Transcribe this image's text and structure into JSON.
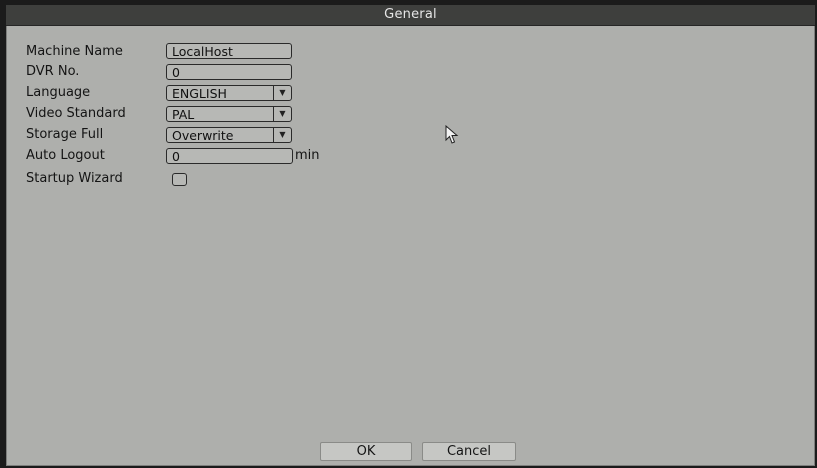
{
  "window": {
    "title": "General"
  },
  "form": {
    "machine_name": {
      "label": "Machine Name",
      "value": "LocalHost"
    },
    "dvr_no": {
      "label": "DVR No.",
      "value": "0"
    },
    "language": {
      "label": "Language",
      "value": "ENGLISH"
    },
    "video_standard": {
      "label": "Video Standard",
      "value": "PAL"
    },
    "storage_full": {
      "label": "Storage Full",
      "value": "Overwrite"
    },
    "auto_logout": {
      "label": "Auto Logout",
      "value": "0",
      "unit": "min"
    },
    "startup_wizard": {
      "label": "Startup Wizard",
      "checked": false
    }
  },
  "buttons": {
    "ok": "OK",
    "cancel": "Cancel"
  },
  "icons": {
    "dropdown": "chevron-down-icon",
    "pointer": "mouse-pointer-icon"
  },
  "colors": {
    "background": "#aeafac",
    "titlebar": "#3e3f3d",
    "title_text": "#e6e6e6"
  }
}
